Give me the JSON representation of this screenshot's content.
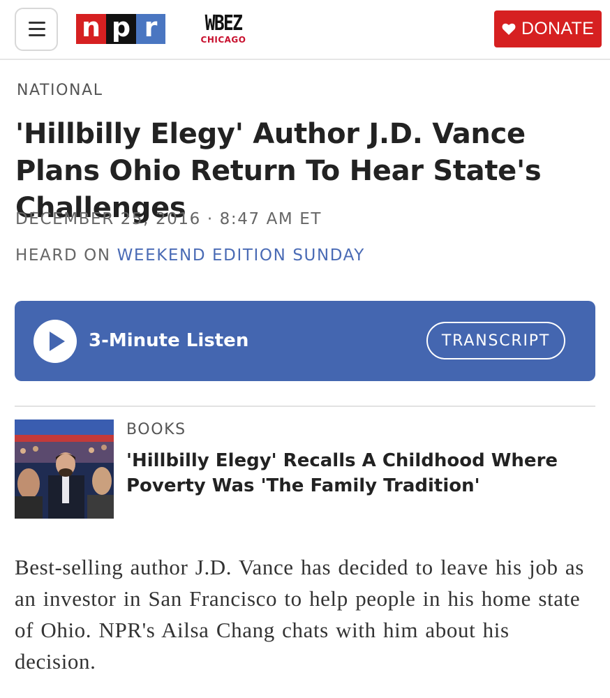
{
  "header": {
    "menu_icon": "hamburger-menu-icon",
    "logo": {
      "letters": [
        "n",
        "p",
        "r"
      ],
      "colors": [
        "#d62021",
        "#111111",
        "#4a76c1"
      ]
    },
    "station": {
      "call_letters": "WBEZ",
      "city": "CHICAGO"
    },
    "donate": {
      "label": "DONATE",
      "icon": "heart-icon",
      "color": "#d62021"
    }
  },
  "article": {
    "section": "NATIONAL",
    "headline": "'Hillbilly Elegy' Author J.D. Vance Plans Ohio Return To Hear State's Challenges",
    "dateline": "DECEMBER 25, 2016 · 8:47 AM ET",
    "heard_on_prefix": "HEARD ON ",
    "heard_on_show": "WEEKEND EDITION SUNDAY",
    "teaser": "Best-selling author J.D. Vance has decided to leave his job as an investor in San Francisco to help people in his home state of Ohio. NPR's Ailsa Chang chats with him about his decision."
  },
  "player": {
    "play_icon": "play-icon",
    "listen_label": "3-Minute Listen",
    "transcript_label": "TRANSCRIPT",
    "color": "#4466b0"
  },
  "related": {
    "kicker": "BOOKS",
    "title": "'Hillbilly Elegy' Recalls A Childhood Where Poverty Was 'The Family Tradition'"
  }
}
